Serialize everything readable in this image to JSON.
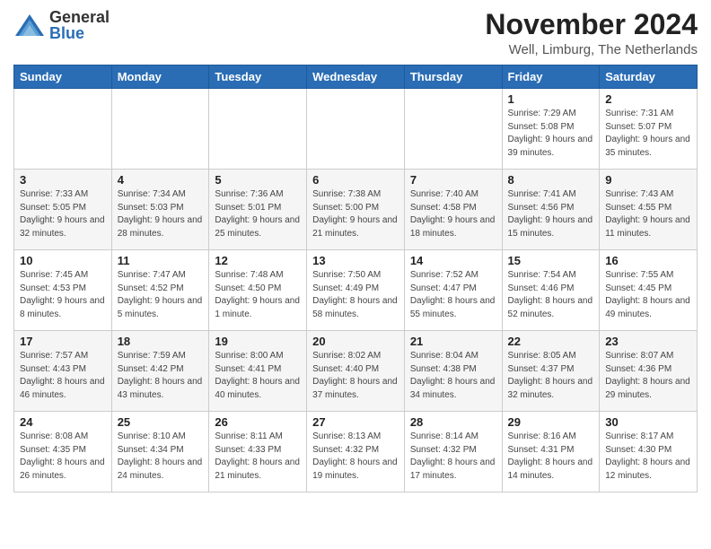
{
  "header": {
    "logo_general": "General",
    "logo_blue": "Blue",
    "title": "November 2024",
    "subtitle": "Well, Limburg, The Netherlands"
  },
  "weekdays": [
    "Sunday",
    "Monday",
    "Tuesday",
    "Wednesday",
    "Thursday",
    "Friday",
    "Saturday"
  ],
  "weeks": [
    [
      {
        "day": "",
        "info": ""
      },
      {
        "day": "",
        "info": ""
      },
      {
        "day": "",
        "info": ""
      },
      {
        "day": "",
        "info": ""
      },
      {
        "day": "",
        "info": ""
      },
      {
        "day": "1",
        "info": "Sunrise: 7:29 AM\nSunset: 5:08 PM\nDaylight: 9 hours and 39 minutes."
      },
      {
        "day": "2",
        "info": "Sunrise: 7:31 AM\nSunset: 5:07 PM\nDaylight: 9 hours and 35 minutes."
      }
    ],
    [
      {
        "day": "3",
        "info": "Sunrise: 7:33 AM\nSunset: 5:05 PM\nDaylight: 9 hours and 32 minutes."
      },
      {
        "day": "4",
        "info": "Sunrise: 7:34 AM\nSunset: 5:03 PM\nDaylight: 9 hours and 28 minutes."
      },
      {
        "day": "5",
        "info": "Sunrise: 7:36 AM\nSunset: 5:01 PM\nDaylight: 9 hours and 25 minutes."
      },
      {
        "day": "6",
        "info": "Sunrise: 7:38 AM\nSunset: 5:00 PM\nDaylight: 9 hours and 21 minutes."
      },
      {
        "day": "7",
        "info": "Sunrise: 7:40 AM\nSunset: 4:58 PM\nDaylight: 9 hours and 18 minutes."
      },
      {
        "day": "8",
        "info": "Sunrise: 7:41 AM\nSunset: 4:56 PM\nDaylight: 9 hours and 15 minutes."
      },
      {
        "day": "9",
        "info": "Sunrise: 7:43 AM\nSunset: 4:55 PM\nDaylight: 9 hours and 11 minutes."
      }
    ],
    [
      {
        "day": "10",
        "info": "Sunrise: 7:45 AM\nSunset: 4:53 PM\nDaylight: 9 hours and 8 minutes."
      },
      {
        "day": "11",
        "info": "Sunrise: 7:47 AM\nSunset: 4:52 PM\nDaylight: 9 hours and 5 minutes."
      },
      {
        "day": "12",
        "info": "Sunrise: 7:48 AM\nSunset: 4:50 PM\nDaylight: 9 hours and 1 minute."
      },
      {
        "day": "13",
        "info": "Sunrise: 7:50 AM\nSunset: 4:49 PM\nDaylight: 8 hours and 58 minutes."
      },
      {
        "day": "14",
        "info": "Sunrise: 7:52 AM\nSunset: 4:47 PM\nDaylight: 8 hours and 55 minutes."
      },
      {
        "day": "15",
        "info": "Sunrise: 7:54 AM\nSunset: 4:46 PM\nDaylight: 8 hours and 52 minutes."
      },
      {
        "day": "16",
        "info": "Sunrise: 7:55 AM\nSunset: 4:45 PM\nDaylight: 8 hours and 49 minutes."
      }
    ],
    [
      {
        "day": "17",
        "info": "Sunrise: 7:57 AM\nSunset: 4:43 PM\nDaylight: 8 hours and 46 minutes."
      },
      {
        "day": "18",
        "info": "Sunrise: 7:59 AM\nSunset: 4:42 PM\nDaylight: 8 hours and 43 minutes."
      },
      {
        "day": "19",
        "info": "Sunrise: 8:00 AM\nSunset: 4:41 PM\nDaylight: 8 hours and 40 minutes."
      },
      {
        "day": "20",
        "info": "Sunrise: 8:02 AM\nSunset: 4:40 PM\nDaylight: 8 hours and 37 minutes."
      },
      {
        "day": "21",
        "info": "Sunrise: 8:04 AM\nSunset: 4:38 PM\nDaylight: 8 hours and 34 minutes."
      },
      {
        "day": "22",
        "info": "Sunrise: 8:05 AM\nSunset: 4:37 PM\nDaylight: 8 hours and 32 minutes."
      },
      {
        "day": "23",
        "info": "Sunrise: 8:07 AM\nSunset: 4:36 PM\nDaylight: 8 hours and 29 minutes."
      }
    ],
    [
      {
        "day": "24",
        "info": "Sunrise: 8:08 AM\nSunset: 4:35 PM\nDaylight: 8 hours and 26 minutes."
      },
      {
        "day": "25",
        "info": "Sunrise: 8:10 AM\nSunset: 4:34 PM\nDaylight: 8 hours and 24 minutes."
      },
      {
        "day": "26",
        "info": "Sunrise: 8:11 AM\nSunset: 4:33 PM\nDaylight: 8 hours and 21 minutes."
      },
      {
        "day": "27",
        "info": "Sunrise: 8:13 AM\nSunset: 4:32 PM\nDaylight: 8 hours and 19 minutes."
      },
      {
        "day": "28",
        "info": "Sunrise: 8:14 AM\nSunset: 4:32 PM\nDaylight: 8 hours and 17 minutes."
      },
      {
        "day": "29",
        "info": "Sunrise: 8:16 AM\nSunset: 4:31 PM\nDaylight: 8 hours and 14 minutes."
      },
      {
        "day": "30",
        "info": "Sunrise: 8:17 AM\nSunset: 4:30 PM\nDaylight: 8 hours and 12 minutes."
      }
    ]
  ]
}
